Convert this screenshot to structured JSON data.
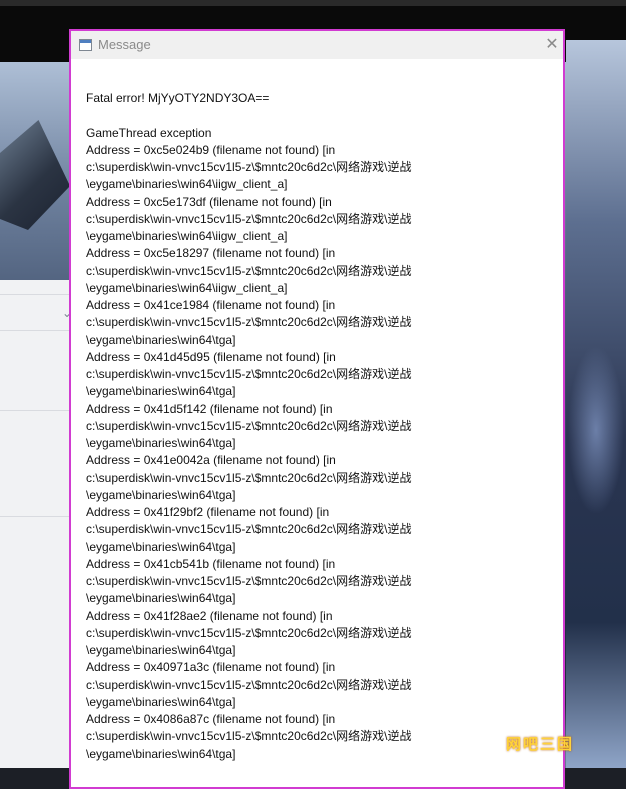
{
  "dialog": {
    "title": "Message",
    "close_glyph": "✕",
    "heading": "Fatal error! MjYyOTY2NDY3OA==",
    "exception": "GameThread exception",
    "entries": [
      {
        "address": "Address = 0xc5e024b9 (filename not found) [in",
        "path": "c:\\superdisk\\win-vnvc15cv1l5-z\\$mntc20c6d2c\\网络游戏\\逆战",
        "module": "\\eygame\\binaries\\win64\\iigw_client_a]"
      },
      {
        "address": "Address = 0xc5e173df (filename not found) [in",
        "path": "c:\\superdisk\\win-vnvc15cv1l5-z\\$mntc20c6d2c\\网络游戏\\逆战",
        "module": "\\eygame\\binaries\\win64\\iigw_client_a]"
      },
      {
        "address": "Address = 0xc5e18297 (filename not found) [in",
        "path": "c:\\superdisk\\win-vnvc15cv1l5-z\\$mntc20c6d2c\\网络游戏\\逆战",
        "module": "\\eygame\\binaries\\win64\\iigw_client_a]"
      },
      {
        "address": "Address = 0x41ce1984 (filename not found) [in",
        "path": "c:\\superdisk\\win-vnvc15cv1l5-z\\$mntc20c6d2c\\网络游戏\\逆战",
        "module": "\\eygame\\binaries\\win64\\tga]"
      },
      {
        "address": "Address = 0x41d45d95 (filename not found) [in",
        "path": "c:\\superdisk\\win-vnvc15cv1l5-z\\$mntc20c6d2c\\网络游戏\\逆战",
        "module": "\\eygame\\binaries\\win64\\tga]"
      },
      {
        "address": "Address = 0x41d5f142 (filename not found) [in",
        "path": "c:\\superdisk\\win-vnvc15cv1l5-z\\$mntc20c6d2c\\网络游戏\\逆战",
        "module": "\\eygame\\binaries\\win64\\tga]"
      },
      {
        "address": "Address = 0x41e0042a (filename not found) [in",
        "path": "c:\\superdisk\\win-vnvc15cv1l5-z\\$mntc20c6d2c\\网络游戏\\逆战",
        "module": "\\eygame\\binaries\\win64\\tga]"
      },
      {
        "address": "Address = 0x41f29bf2 (filename not found) [in",
        "path": "c:\\superdisk\\win-vnvc15cv1l5-z\\$mntc20c6d2c\\网络游戏\\逆战",
        "module": "\\eygame\\binaries\\win64\\tga]"
      },
      {
        "address": "Address = 0x41cb541b (filename not found) [in",
        "path": "c:\\superdisk\\win-vnvc15cv1l5-z\\$mntc20c6d2c\\网络游戏\\逆战",
        "module": "\\eygame\\binaries\\win64\\tga]"
      },
      {
        "address": "Address = 0x41f28ae2 (filename not found) [in",
        "path": "c:\\superdisk\\win-vnvc15cv1l5-z\\$mntc20c6d2c\\网络游戏\\逆战",
        "module": "\\eygame\\binaries\\win64\\tga]"
      },
      {
        "address": "Address = 0x40971a3c (filename not found) [in",
        "path": "c:\\superdisk\\win-vnvc15cv1l5-z\\$mntc20c6d2c\\网络游戏\\逆战",
        "module": "\\eygame\\binaries\\win64\\tga]"
      },
      {
        "address": "Address = 0x4086a87c (filename not found) [in",
        "path": "c:\\superdisk\\win-vnvc15cv1l5-z\\$mntc20c6d2c\\网络游戏\\逆战",
        "module": "\\eygame\\binaries\\win64\\tga]"
      }
    ]
  },
  "watermark": "网吧三国",
  "colors": {
    "dialog_border": "#d13bd1",
    "watermark": "#ffd23a"
  }
}
